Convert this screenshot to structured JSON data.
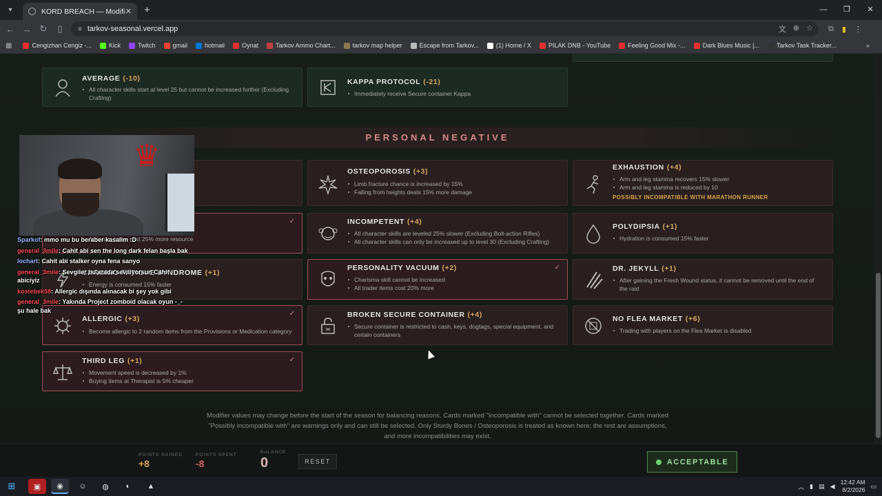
{
  "browser": {
    "tab_title": "KORD BREACH — Modifier Buil...",
    "url": "tarkov-seasonal.vercel.app",
    "bookmarks": [
      {
        "label": "Cengizhan Cengiz -...",
        "color": "#e03030"
      },
      {
        "label": "Kick",
        "color": "#53fc18"
      },
      {
        "label": "Twitch",
        "color": "#9146ff"
      },
      {
        "label": "gmail",
        "color": "#ea4335"
      },
      {
        "label": "hotmail",
        "color": "#0078d4"
      },
      {
        "label": "Oynat",
        "color": "#e03030"
      },
      {
        "label": "Tarkov Ammo Chart...",
        "color": "#c04040"
      },
      {
        "label": "tarkov map helper",
        "color": "#8a7a50"
      },
      {
        "label": "Escape from Tarkov...",
        "color": "#bbbbbb"
      },
      {
        "label": "(1) Home / X",
        "color": "#ffffff"
      },
      {
        "label": "PILAK DNB - YouTube",
        "color": "#e03030"
      },
      {
        "label": "Feeling Good Mix -...",
        "color": "#e03030"
      },
      {
        "label": "Dark Blues Music |...",
        "color": "#e03030"
      },
      {
        "label": "Tarkov Task Tracker...",
        "color": "#333333"
      }
    ]
  },
  "top_cards": [
    {
      "title": "AVERAGE",
      "points": "(-10)",
      "lines": [
        "All character skills start at level 25 but cannot be increased further (Excluding Crafting)"
      ]
    },
    {
      "title": "KAPPA PROTOCOL",
      "points": "(-21)",
      "lines": [
        "Immediately receive Secure container Kappa"
      ]
    }
  ],
  "section_title": "PERSONAL NEGATIVE",
  "left_cards": [
    {
      "title": "",
      "points": "",
      "lines": [],
      "selected": false
    },
    {
      "title": "",
      "points": "",
      "lines": [
        "All trader items cost 25% more resource"
      ],
      "selected": true
    },
    {
      "title": "CHRONIC FATIGUE SYNDROME",
      "points": "(+1)",
      "lines": [
        "Energy is consumed 15% faster"
      ],
      "selected": false
    },
    {
      "title": "ALLERGIC",
      "points": "(+3)",
      "lines": [
        "Become allergic to 2 random items from the Provisions or Medication category"
      ],
      "selected": true
    },
    {
      "title": "THIRD LEG",
      "points": "(+1)",
      "lines": [
        "Movement speed is decreased by 1%",
        "Buying items at Therapist is 5% cheaper"
      ],
      "selected": true
    }
  ],
  "mid_cards": [
    {
      "title": "OSTEOPOROSIS",
      "points": "(+3)",
      "lines": [
        "Limb fracture chance is increased by 15%",
        "Falling from heights deals 15% more damage"
      ],
      "selected": false
    },
    {
      "title": "INCOMPETENT",
      "points": "(+4)",
      "lines": [
        "All character skills are leveled 25% slower (Excluding Bolt-action Rifles)",
        "All character skills can only be increased up to level 30 (Excluding Crafting)"
      ],
      "selected": false
    },
    {
      "title": "PERSONALITY VACUUM",
      "points": "(+2)",
      "lines": [
        "Charisma skill cannot be increased",
        "All trader items cost 20% more"
      ],
      "selected": true
    },
    {
      "title": "BROKEN SECURE CONTAINER",
      "points": "(+4)",
      "lines": [
        "Secure container is restricted to cash, keys, dogtags, special equipment, and certain containers"
      ],
      "selected": false
    }
  ],
  "right_cards": [
    {
      "title": "EXHAUSTION",
      "points": "(+4)",
      "lines": [
        "Arm and leg stamina recovers 15% slower",
        "Arm and leg stamina is reduced by 10"
      ],
      "warning": "POSSIBLY INCOMPATIBLE WITH MARATHON RUNNER",
      "selected": false
    },
    {
      "title": "POLYDIPSIA",
      "points": "(+1)",
      "lines": [
        "Hydration is consumed 15% faster"
      ],
      "warning": "",
      "selected": false
    },
    {
      "title": "DR. JEKYLL",
      "points": "(+1)",
      "lines": [
        "After gaining the Fresh Wound status, it cannot be removed until the end of the raid"
      ],
      "warning": "",
      "selected": false
    },
    {
      "title": "NO FLEA MARKET",
      "points": "(+6)",
      "lines": [
        "Trading with players on the Flea Market is disabled"
      ],
      "warning": "",
      "selected": false
    }
  ],
  "footnote": "Modifier values may change before the start of the season for balancing reasons. Cards marked \"Incompatible with\" cannot be selected together. Cards marked \"Possibly incompatible with\" are warnings only and can still be selected. Only Sturdy Bones / Osteoporosis is treated as known here; the rest are assumptions, and more incompatibilities may exist.",
  "bottom": {
    "gained_label": "POINTS GAINED",
    "gained_value": "+8",
    "spent_label": "POINTS SPENT",
    "spent_value": "-8",
    "balance_label": "BALANCE",
    "balance_value": "0",
    "reset_label": "RESET",
    "status_label": "ACCEPTABLE"
  },
  "chat": [
    {
      "user": "Sparkof",
      "text": ": mmo mu bu beraber kasalim :D",
      "alt": true
    },
    {
      "user": "general_3mile",
      "text": ": Cahit abi sen the long dark felan başla bak",
      "alt": false
    },
    {
      "user": "lochart",
      "text": ": Cahit abi stalker oyna fena sanyo",
      "alt": true
    },
    {
      "user": "general_3mile",
      "text": ": Sevgiler bu arada seviliyorsun Cahit abiciyiz",
      "alt": false
    },
    {
      "user": "kostebek58",
      "text": ": Allergic dışında alınacak bi şey yok gibi",
      "alt": false
    },
    {
      "user": "general_3mile",
      "text": ": Yakında Project zomboid olacak oyun -_- şu hale bak",
      "alt": false
    }
  ],
  "taskbar": {
    "time": "12:42 AM",
    "date": "8/2/2026"
  }
}
